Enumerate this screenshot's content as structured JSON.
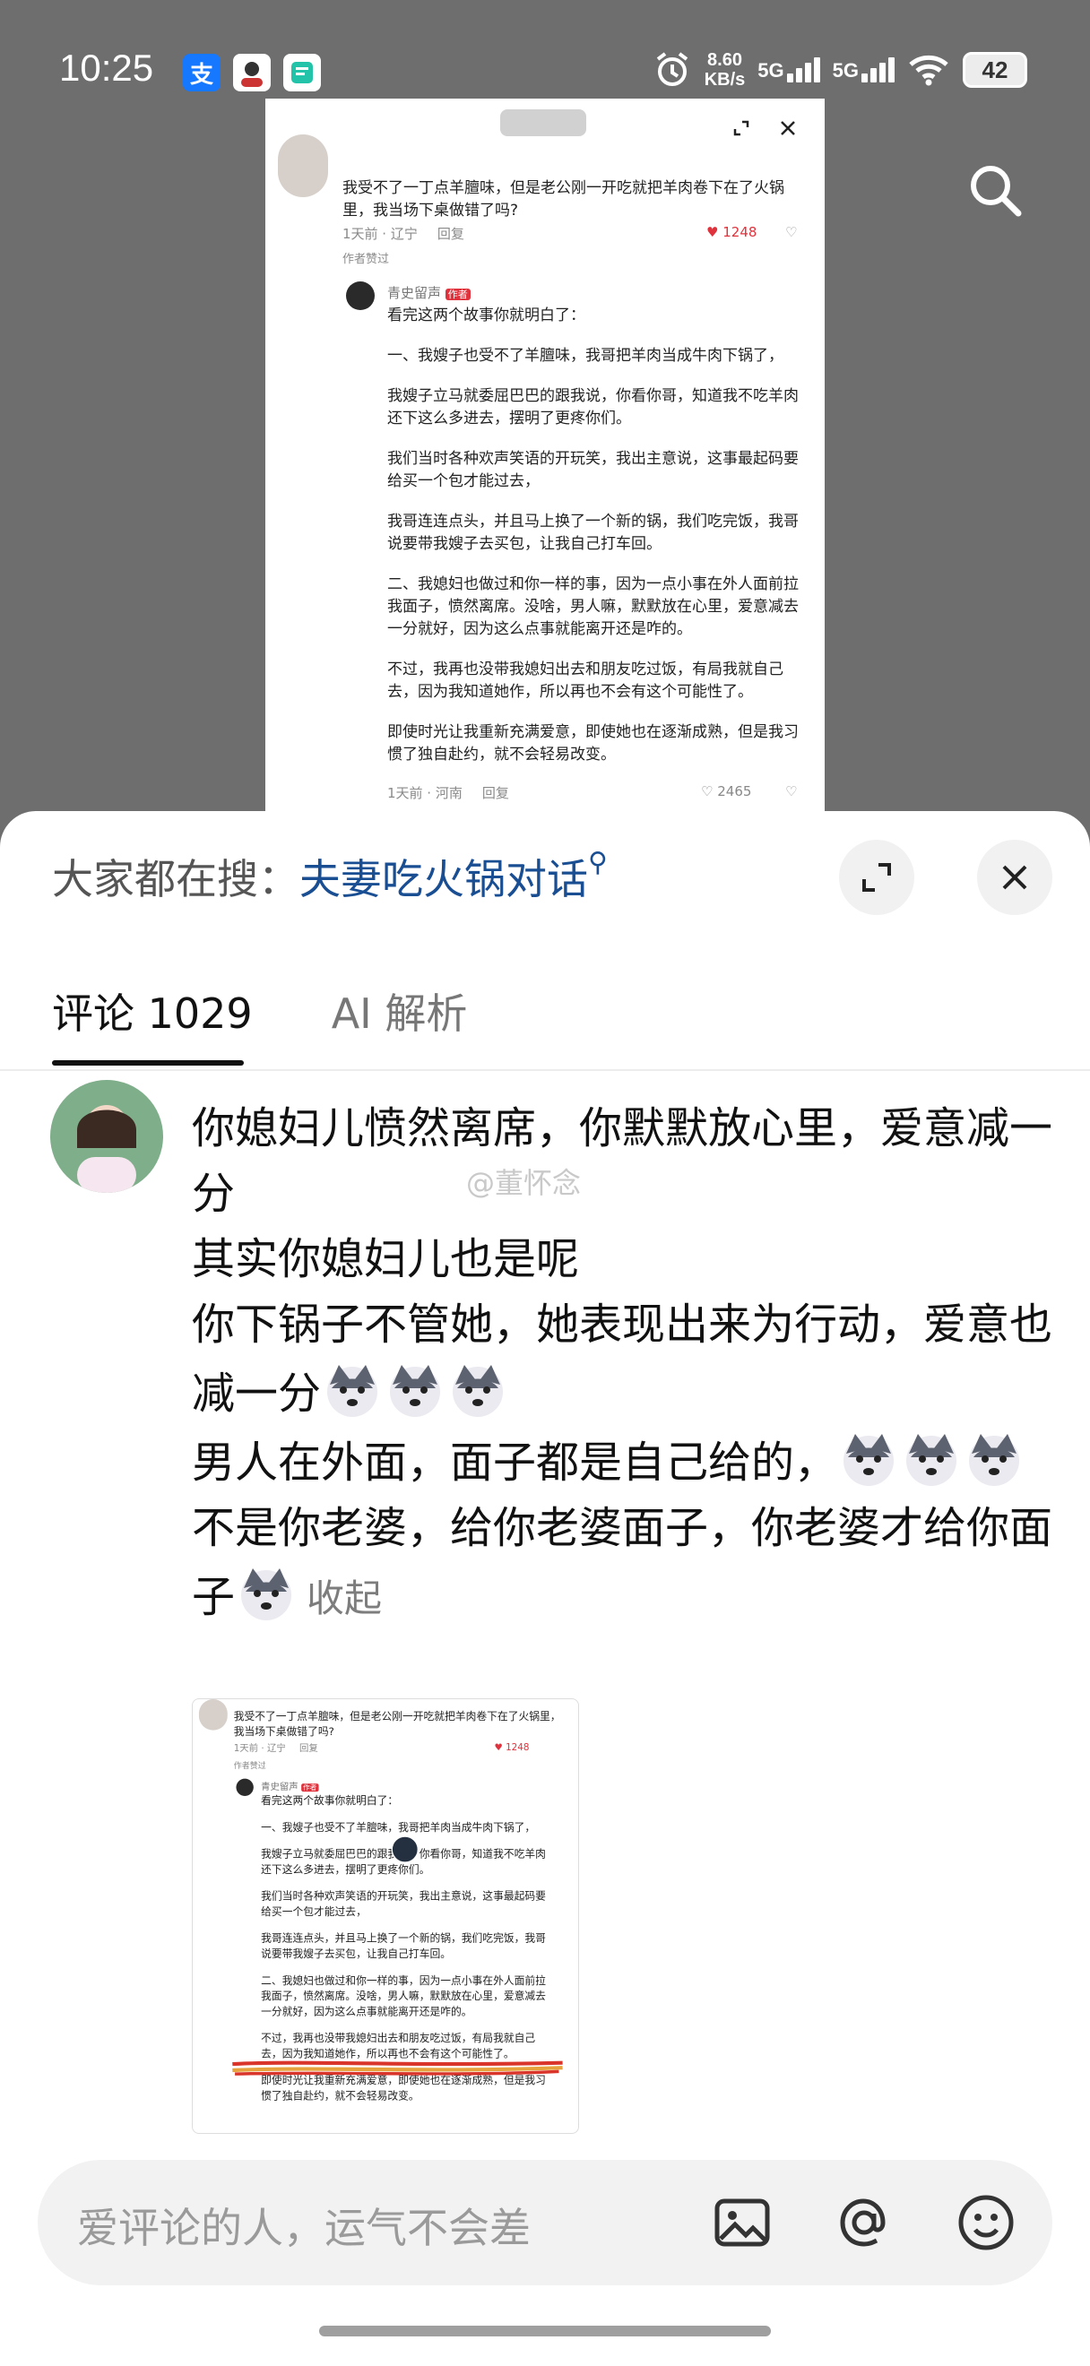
{
  "status": {
    "time": "10:25",
    "net_speed_value": "8.60",
    "net_speed_unit": "KB/s",
    "signal1": "5G",
    "signal2": "5G",
    "battery": "42"
  },
  "preview": {
    "question": "我受不了一丁点羊膻味，但是老公刚一开吃就把羊肉卷下在了火锅里，我当场下桌做错了吗?",
    "q_time": "1天前 · 辽宁",
    "reply_label": "回复",
    "q_likes": "1248",
    "author_liked": "作者赞过",
    "reply_user": "青史留声",
    "author_tag": "作者",
    "reply_paragraphs": [
      "看完这两个故事你就明白了：",
      "一、我嫂子也受不了羊膻味，我哥把羊肉当成牛肉下锅了，",
      "我嫂子立马就委屈巴巴的跟我说，你看你哥，知道我不吃羊肉还下这么多进去，摆明了更疼你们。",
      "我们当时各种欢声笑语的开玩笑，我出主意说，这事最起码要给买一个包才能过去，",
      "我哥连连点头，并且马上换了一个新的锅，我们吃完饭，我哥说要带我嫂子去买包，让我自己打车回。",
      "二、我媳妇也做过和你一样的事，因为一点小事在外人面前拉我面子，愤然离席。没啥，男人嘛，默默放在心里，爱意减去一分就好，因为这么点事就能离开还是咋的。",
      "不过，我再也没带我媳妇出去和朋友吃过饭，有局我就自己去，因为我知道她作，所以再也不会有这个可能性了。",
      "即使时光让我重新充满爱意，即使她也在逐渐成熟，但是我习惯了独自赴约，就不会轻易改变。"
    ],
    "r_time": "1天前 · 河南",
    "r_likes": "2465"
  },
  "sheet": {
    "hot_label": "大家都在搜：",
    "hot_term": "夫妻吃火锅对话",
    "tabs": [
      {
        "label": "评论 1029"
      },
      {
        "label": "AI 解析"
      }
    ],
    "comment_lines": [
      "你媳妇儿愤然离席，你默默放心里，爱意减一分",
      "其实你媳妇儿也是呢",
      "你下锅子不管她，她表现出来为行动，爱意也减一分",
      "男人在外面，面子都是自己给的，",
      "不是你老婆，给你老婆面子，你老婆才给你面子"
    ],
    "collapse_label": "收起",
    "watermark": "@董怀念",
    "input_placeholder": "爱评论的人，运气不会差"
  },
  "colors": {
    "accent_link": "#1a4e93",
    "like_red": "#e0323c",
    "underline_highlight": "#d9352b"
  },
  "icons": [
    "search-icon",
    "expand-icon",
    "close-icon",
    "image-icon",
    "at-icon",
    "emoji-icon",
    "heart-icon"
  ]
}
